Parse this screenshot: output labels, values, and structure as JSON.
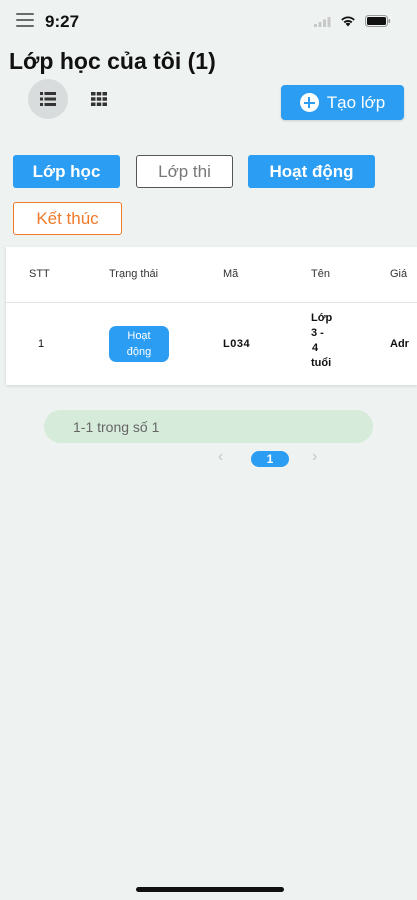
{
  "status_bar": {
    "time": "9:27"
  },
  "header": {
    "title": "Lớp học của tôi (1)"
  },
  "toolbar": {
    "create_label": "Tạo lớp"
  },
  "filters": [
    "Lớp học",
    "Lớp thi",
    "Hoạt động",
    "Kết thúc"
  ],
  "table": {
    "columns": [
      "STT",
      "Trạng thái",
      "Mã",
      "Tên",
      "Giá"
    ],
    "rows": [
      {
        "stt": "1",
        "status_line1": "Hoạt",
        "status_line2": "động",
        "code": "L034",
        "name_lines": [
          "Lớp",
          "3 -",
          "4",
          "tuổi"
        ],
        "last": "Adr"
      }
    ]
  },
  "pagination": {
    "range_text": "1-1 trong số 1",
    "prev": "‹",
    "current_page": "1",
    "next": "›"
  },
  "colors": {
    "accent": "#2b9df3",
    "danger": "#f07a2a",
    "background": "#eef2f1",
    "range_bg": "#d6ebda"
  }
}
